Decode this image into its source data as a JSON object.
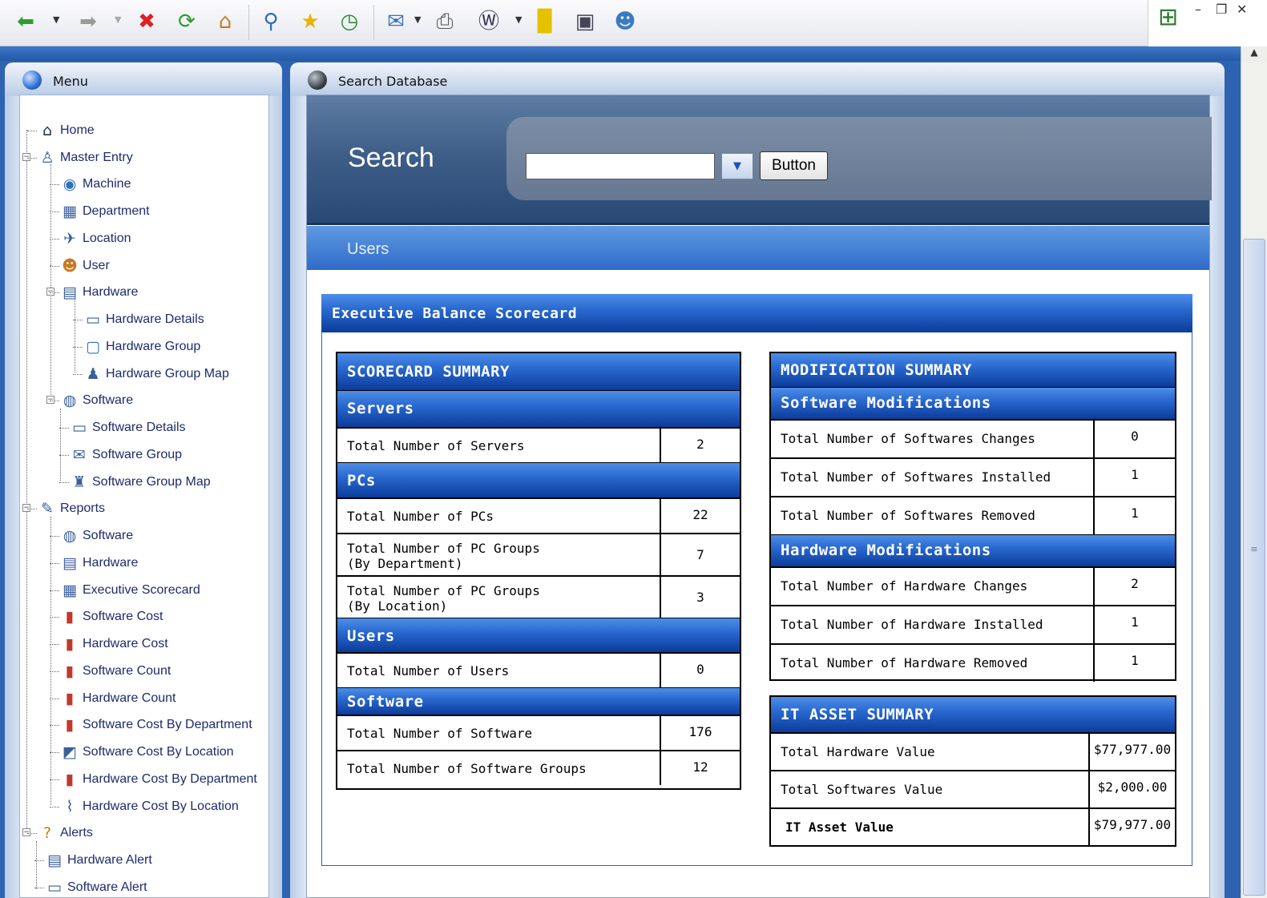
{
  "toolbar": {
    "buttons": [
      "back-icon",
      "forward-icon",
      "stop-icon",
      "refresh-icon",
      "home-icon",
      "search-icon",
      "favorites-icon",
      "history-icon",
      "mail-icon",
      "print-icon",
      "edit-icon",
      "notes-icon",
      "research-icon",
      "messenger-icon"
    ]
  },
  "window": {
    "minimize": "–",
    "restore": "❐",
    "close": "✕"
  },
  "menu": {
    "title": "Menu",
    "items": [
      {
        "label": "Home",
        "icon": "home-icon"
      },
      {
        "label": "Master Entry",
        "icon": "user-outline-icon"
      },
      {
        "label": "Machine",
        "icon": "machine-icon"
      },
      {
        "label": "Department",
        "icon": "department-icon"
      },
      {
        "label": "Location",
        "icon": "location-icon"
      },
      {
        "label": "User",
        "icon": "user-icon"
      },
      {
        "label": "Hardware",
        "icon": "hardware-icon"
      },
      {
        "label": "Hardware Details",
        "icon": "hardware-details-icon"
      },
      {
        "label": "Hardware Group",
        "icon": "hardware-group-icon"
      },
      {
        "label": "Hardware Group Map",
        "icon": "group-map-icon"
      },
      {
        "label": "Software",
        "icon": "software-icon"
      },
      {
        "label": "Software Details",
        "icon": "software-details-icon"
      },
      {
        "label": "Software Group",
        "icon": "software-group-icon"
      },
      {
        "label": "Software Group Map",
        "icon": "software-group-map-icon"
      },
      {
        "label": "Reports",
        "icon": "reports-icon"
      },
      {
        "label": "Software",
        "icon": "software-report-icon"
      },
      {
        "label": "Hardware",
        "icon": "hardware-report-icon"
      },
      {
        "label": "Executive Scorecard",
        "icon": "scorecard-icon"
      },
      {
        "label": "Software Cost",
        "icon": "bar-chart-icon"
      },
      {
        "label": "Hardware Cost",
        "icon": "bar-chart-icon"
      },
      {
        "label": "Software Count",
        "icon": "bar-chart-icon"
      },
      {
        "label": "Hardware Count",
        "icon": "bar-chart-icon"
      },
      {
        "label": "Software Cost By Department",
        "icon": "bar-chart-icon"
      },
      {
        "label": "Software Cost By Location",
        "icon": "chart-icon"
      },
      {
        "label": "Hardware Cost By Department",
        "icon": "bar-chart-icon"
      },
      {
        "label": "Hardware Cost By Location",
        "icon": "line-chart-icon"
      },
      {
        "label": "Alerts",
        "icon": "alert-icon"
      },
      {
        "label": "Hardware Alert",
        "icon": "hardware-alert-icon"
      },
      {
        "label": "Software Alert",
        "icon": "software-alert-icon"
      }
    ]
  },
  "main": {
    "title": "Search Database",
    "search": {
      "title": "Search",
      "input_value": "",
      "button": "Button"
    },
    "users_label": "Users",
    "scorecard_title": "Executive Balance Scorecard",
    "scorecard_summary": {
      "title": "SCORECARD SUMMARY",
      "sections": [
        {
          "title": "Servers",
          "rows": [
            {
              "label": "Total Number of Servers",
              "value": "2"
            }
          ]
        },
        {
          "title": "PCs",
          "rows": [
            {
              "label": "Total Number of PCs",
              "value": "22"
            },
            {
              "label": "Total Number of PC Groups\n(By Department)",
              "value": "7"
            },
            {
              "label": "Total Number of PC Groups\n(By Location)",
              "value": "3"
            }
          ]
        },
        {
          "title": "Users",
          "rows": [
            {
              "label": "Total Number of Users",
              "value": "0"
            }
          ]
        },
        {
          "title": "Software",
          "rows": [
            {
              "label": "Total Number of Software",
              "value": "176"
            },
            {
              "label": "Total Number of Software Groups",
              "value": "12"
            }
          ]
        }
      ]
    },
    "modification_summary": {
      "title": "MODIFICATION SUMMARY",
      "sections": [
        {
          "title": "Software Modifications",
          "rows": [
            {
              "label": "Total Number of Softwares Changes",
              "value": "0"
            },
            {
              "label": "Total Number of Softwares Installed",
              "value": "1"
            },
            {
              "label": "Total Number of Softwares Removed",
              "value": "1"
            }
          ]
        },
        {
          "title": "Hardware Modifications",
          "rows": [
            {
              "label": "Total Number of Hardware Changes",
              "value": "2"
            },
            {
              "label": "Total Number of Hardware Installed",
              "value": "1"
            },
            {
              "label": "Total Number of Hardware Removed",
              "value": "1"
            }
          ]
        }
      ]
    },
    "it_asset_summary": {
      "title": "IT ASSET SUMMARY",
      "rows": [
        {
          "label": "Total Hardware Value",
          "value": "$77,977.00"
        },
        {
          "label": "Total Softwares Value",
          "value": "$2,000.00"
        },
        {
          "label": "IT Asset Value",
          "value": "$79,977.00"
        }
      ]
    }
  }
}
